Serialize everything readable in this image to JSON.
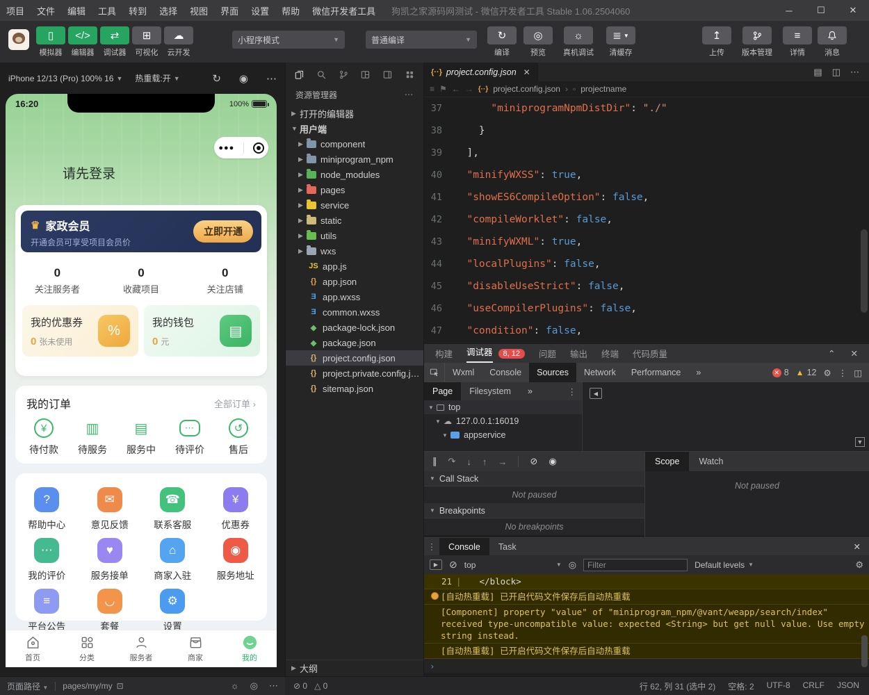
{
  "titlebar": {
    "menus": [
      "项目",
      "文件",
      "编辑",
      "工具",
      "转到",
      "选择",
      "视图",
      "界面",
      "设置",
      "帮助",
      "微信开发者工具"
    ],
    "title": "狗凯之家源码网测试 - 微信开发者工具 Stable 1.06.2504060"
  },
  "toolbar": {
    "modes": [
      {
        "label": "模拟器",
        "glyph": "▯",
        "active": true
      },
      {
        "label": "编辑器",
        "glyph": "</>",
        "active": true
      },
      {
        "label": "调试器",
        "glyph": "⇄",
        "active": true
      },
      {
        "label": "可视化",
        "glyph": "⊞",
        "active": false
      },
      {
        "label": "云开发",
        "glyph": "☁",
        "active": false
      }
    ],
    "mode_dropdown": "小程序模式",
    "compile_dropdown": "普通编译",
    "compile": "编译",
    "preview": "预览",
    "device_debug": "真机调试",
    "clear_cache": "清缓存",
    "upload": "上传",
    "version": "版本管理",
    "detail": "详情",
    "message": "消息"
  },
  "simulator": {
    "device_label": "iPhone 12/13 (Pro) 100% 16",
    "hot_reload": "热重载:开",
    "time": "16:20",
    "battery": "100%",
    "login": "请先登录",
    "member": {
      "title": "家政会员",
      "subtitle": "开通会员可享受项目会员价",
      "cta": "立即开通"
    },
    "stats": [
      {
        "value": "0",
        "label": "关注服务者"
      },
      {
        "value": "0",
        "label": "收藏项目"
      },
      {
        "value": "0",
        "label": "关注店铺"
      }
    ],
    "coupon": {
      "title": "我的优惠券",
      "count": "0",
      "unit": "张未使用"
    },
    "wallet": {
      "title": "我的钱包",
      "count": "0",
      "unit": "元"
    },
    "orders": {
      "title": "我的订单",
      "more": "全部订单",
      "items": [
        {
          "label": "待付款"
        },
        {
          "label": "待服务"
        },
        {
          "label": "服务中"
        },
        {
          "label": "待评价"
        },
        {
          "label": "售后"
        }
      ]
    },
    "grid": [
      {
        "label": "帮助中心",
        "glyph": "?",
        "color": "#5a8ff0"
      },
      {
        "label": "意见反馈",
        "glyph": "✉",
        "color": "#f08a4b"
      },
      {
        "label": "联系客服",
        "glyph": "☎",
        "color": "#43c27e"
      },
      {
        "label": "优惠券",
        "glyph": "¥",
        "color": "#8d7bf0"
      },
      {
        "label": "我的评价",
        "glyph": "⋯",
        "color": "#45b98f"
      },
      {
        "label": "服务接单",
        "glyph": "♥",
        "color": "#9b87f2"
      },
      {
        "label": "商家入驻",
        "glyph": "⌂",
        "color": "#55a4f0"
      },
      {
        "label": "服务地址",
        "glyph": "◉",
        "color": "#ef5a47"
      },
      {
        "label": "平台公告",
        "glyph": "≡",
        "color": "#8f9af2"
      },
      {
        "label": "套餐",
        "glyph": "◡",
        "color": "#f2954b"
      },
      {
        "label": "设置",
        "glyph": "⚙",
        "color": "#4b9bf0"
      }
    ],
    "tabbar": [
      {
        "label": "首页"
      },
      {
        "label": "分类"
      },
      {
        "label": "服务者"
      },
      {
        "label": "商家"
      },
      {
        "label": "我的",
        "active": true
      }
    ],
    "page_path_label": "页面路径",
    "page_path": "pages/my/my"
  },
  "explorer": {
    "title": "资源管理器",
    "open_editors": "打开的编辑器",
    "root": "用户端",
    "folders": [
      {
        "name": "component",
        "color": "#8494a8"
      },
      {
        "name": "miniprogram_npm",
        "color": "#8494a8"
      },
      {
        "name": "node_modules",
        "color": "#59b25a"
      },
      {
        "name": "pages",
        "color": "#e2695a"
      },
      {
        "name": "service",
        "color": "#ecc52e"
      },
      {
        "name": "static",
        "color": "#cdb97a"
      },
      {
        "name": "utils",
        "color": "#67bb4f"
      },
      {
        "name": "wxs",
        "color": "#9aa6b2"
      }
    ],
    "files": [
      {
        "name": "app.js",
        "glyph": "JS",
        "color": "#ecc52e"
      },
      {
        "name": "app.json",
        "glyph": "{}",
        "color": "#e8a33d"
      },
      {
        "name": "app.wxss",
        "glyph": "Ǝ",
        "color": "#4da3e8"
      },
      {
        "name": "common.wxss",
        "glyph": "Ǝ",
        "color": "#4da3e8"
      },
      {
        "name": "package-lock.json",
        "glyph": "◆",
        "color": "#6abf69"
      },
      {
        "name": "package.json",
        "glyph": "◆",
        "color": "#6abf69"
      },
      {
        "name": "project.config.json",
        "glyph": "{}",
        "color": "#d8b36a",
        "selected": true
      },
      {
        "name": "project.private.config.js…",
        "glyph": "{}",
        "color": "#d8b36a"
      },
      {
        "name": "sitemap.json",
        "glyph": "{}",
        "color": "#d8b36a"
      }
    ],
    "outline": "大纲"
  },
  "editor": {
    "tab_name": "project.config.json",
    "crumb_file": "project.config.json",
    "crumb_node": "projectname",
    "lines": [
      {
        "num": "37",
        "pre": "      ",
        "key": "\"miniprogramNpmDistDir\"",
        "sep": ": ",
        "val": "\"./\"",
        "vc": "#ce9178",
        "end": ""
      },
      {
        "num": "38",
        "pre": "    }"
      },
      {
        "num": "39",
        "pre": "  ],"
      },
      {
        "num": "40",
        "pre": "  ",
        "key": "\"minifyWXSS\"",
        "sep": ": ",
        "val": "true",
        "vc": "#569cd6",
        "end": ","
      },
      {
        "num": "41",
        "pre": "  ",
        "key": "\"showES6CompileOption\"",
        "sep": ": ",
        "val": "false",
        "vc": "#569cd6",
        "end": ","
      },
      {
        "num": "42",
        "pre": "  ",
        "key": "\"compileWorklet\"",
        "sep": ": ",
        "val": "false",
        "vc": "#569cd6",
        "end": ","
      },
      {
        "num": "43",
        "pre": "  ",
        "key": "\"minifyWXML\"",
        "sep": ": ",
        "val": "true",
        "vc": "#569cd6",
        "end": ","
      },
      {
        "num": "44",
        "pre": "  ",
        "key": "\"localPlugins\"",
        "sep": ": ",
        "val": "false",
        "vc": "#569cd6",
        "end": ","
      },
      {
        "num": "45",
        "pre": "  ",
        "key": "\"disableUseStrict\"",
        "sep": ": ",
        "val": "false",
        "vc": "#569cd6",
        "end": ","
      },
      {
        "num": "46",
        "pre": "  ",
        "key": "\"useCompilerPlugins\"",
        "sep": ": ",
        "val": "false",
        "vc": "#569cd6",
        "end": ","
      },
      {
        "num": "47",
        "pre": "  ",
        "key": "\"condition\"",
        "sep": ": ",
        "val": "false",
        "vc": "#569cd6",
        "end": ","
      }
    ]
  },
  "debugpanel": {
    "build": "构建",
    "debugger": "调试器",
    "badge": "8, 12",
    "problems": "问题",
    "output": "输出",
    "terminal": "终端",
    "quality": "代码质量"
  },
  "devtools": {
    "tabs": [
      {
        "label": "Wxml"
      },
      {
        "label": "Console"
      },
      {
        "label": "Sources",
        "active": true
      },
      {
        "label": "Network"
      },
      {
        "label": "Performance"
      }
    ],
    "errors": "8",
    "warnings": "12",
    "sources": {
      "page_tab": "Page",
      "fs_tab": "Filesystem",
      "tree_top": "top",
      "tree_host": "127.0.0.1:16019",
      "tree_folder": "appservice",
      "call_stack": "Call Stack",
      "not_paused": "Not paused",
      "breakpoints": "Breakpoints",
      "no_breakpoints": "No breakpoints",
      "scope": "Scope",
      "watch": "Watch"
    },
    "console": {
      "tab_console": "Console",
      "tab_task": "Task",
      "context": "top",
      "filter_placeholder": "Filter",
      "levels": "Default levels",
      "code_row": {
        "num": "21",
        "code": "</block>"
      },
      "messages": [
        {
          "dot": true,
          "text": "[自动热重载] 已开启代码文件保存后自动热重载"
        },
        {
          "warn": true,
          "text": "[Component] property \"value\" of \"miniprogram_npm/@vant/weapp/search/index\" received type-uncompatible value: expected <String> but get null value. Use empty string instead."
        },
        {
          "warn": true,
          "text": "[自动热重载] 已开启代码文件保存后自动热重载"
        }
      ]
    }
  },
  "statusbar": {
    "errors": "0",
    "warnings": "0",
    "cursor": "行 62, 列 31 (选中 2)",
    "spaces": "空格: 2",
    "encoding": "UTF-8",
    "eol": "CRLF",
    "lang": "JSON"
  }
}
